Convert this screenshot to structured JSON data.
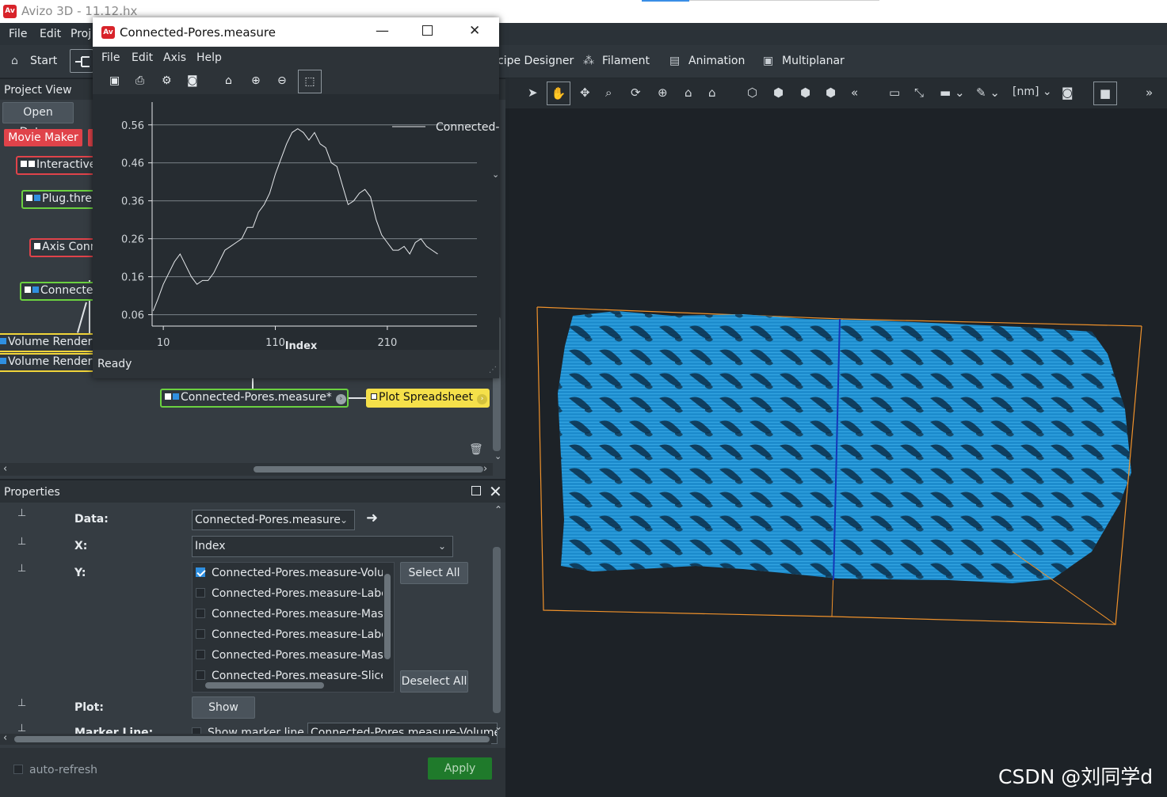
{
  "app": {
    "title": "Avizo 3D - 11.12.hx",
    "logo_text": "Av"
  },
  "menu": [
    "File",
    "Edit",
    "Proj"
  ],
  "workrooms": {
    "start": "Start",
    "recipe": "cipe Designer",
    "filament": "Filament",
    "animation": "Animation",
    "multiplanar": "Multiplanar"
  },
  "project_view": {
    "title": "Project View",
    "open_data": "Open Data...",
    "movie_maker": "Movie Maker",
    "nodes": {
      "interactive": "Interactive",
      "plug": "Plug.thre",
      "axis": "Axis Conn",
      "connected": "Connecte",
      "volume1": "Volume Render",
      "volume2": "Volume Render",
      "measure": "Connected-Pores.measure*",
      "plot_spreadsheet": "Plot Spreadsheet"
    }
  },
  "properties": {
    "title": "Properties",
    "data_label": "Data:",
    "data_value": "Connected-Pores.measure",
    "x_label": "X:",
    "x_value": "Index",
    "y_label": "Y:",
    "y_items": [
      {
        "label": "Connected-Pores.measure-Volur",
        "checked": true
      },
      {
        "label": "Connected-Pores.measure-Label",
        "checked": false
      },
      {
        "label": "Connected-Pores.measure-Mask",
        "checked": false
      },
      {
        "label": "Connected-Pores.measure-Label",
        "checked": false
      },
      {
        "label": "Connected-Pores.measure-Mask",
        "checked": false
      },
      {
        "label": "Connected-Pores.measure-Slice",
        "checked": false
      }
    ],
    "select_all": "Select All",
    "deselect_all": "Deselect All",
    "plot_label": "Plot:",
    "show": "Show",
    "marker_label": "Marker Line:",
    "marker_checkbox": "Show marker line",
    "marker_value": "Connected-Pores.measure-Volume",
    "auto_refresh": "auto-refresh",
    "apply": "Apply"
  },
  "viewer": {
    "unit": "[nm]",
    "colors": {
      "volume": "#1b8fd0",
      "bbox": "#f0922b"
    }
  },
  "plot_window": {
    "title": "Connected-Pores.measure",
    "logo_text": "Av",
    "menu": [
      "File",
      "Edit",
      "Axis",
      "Help"
    ],
    "status": "Ready"
  },
  "chart_data": {
    "type": "line",
    "title": "",
    "xlabel": "Index",
    "ylabel": "",
    "xlim": [
      0,
      290
    ],
    "ylim": [
      0.03,
      0.62
    ],
    "xticks": [
      10,
      110,
      210
    ],
    "yticks": [
      0.06,
      0.16,
      0.26,
      0.36,
      0.46,
      0.56
    ],
    "legend": "top-right",
    "grid": true,
    "series": [
      {
        "name": "Connected-I",
        "x": [
          1,
          5,
          10,
          15,
          20,
          25,
          30,
          35,
          40,
          45,
          50,
          55,
          60,
          65,
          70,
          75,
          80,
          85,
          90,
          95,
          100,
          105,
          110,
          115,
          120,
          125,
          130,
          135,
          140,
          145,
          150,
          155,
          160,
          165,
          170,
          175,
          180,
          185,
          190,
          195,
          200,
          205,
          210,
          215,
          220,
          225,
          230,
          235,
          240,
          245,
          250,
          255
        ],
        "y": [
          0.07,
          0.1,
          0.14,
          0.17,
          0.2,
          0.22,
          0.19,
          0.16,
          0.14,
          0.15,
          0.15,
          0.17,
          0.2,
          0.23,
          0.24,
          0.25,
          0.26,
          0.29,
          0.29,
          0.33,
          0.35,
          0.38,
          0.43,
          0.47,
          0.51,
          0.54,
          0.55,
          0.54,
          0.52,
          0.54,
          0.51,
          0.5,
          0.46,
          0.45,
          0.4,
          0.35,
          0.36,
          0.38,
          0.39,
          0.37,
          0.31,
          0.27,
          0.25,
          0.23,
          0.23,
          0.24,
          0.22,
          0.25,
          0.26,
          0.24,
          0.23,
          0.22
        ]
      }
    ]
  }
}
